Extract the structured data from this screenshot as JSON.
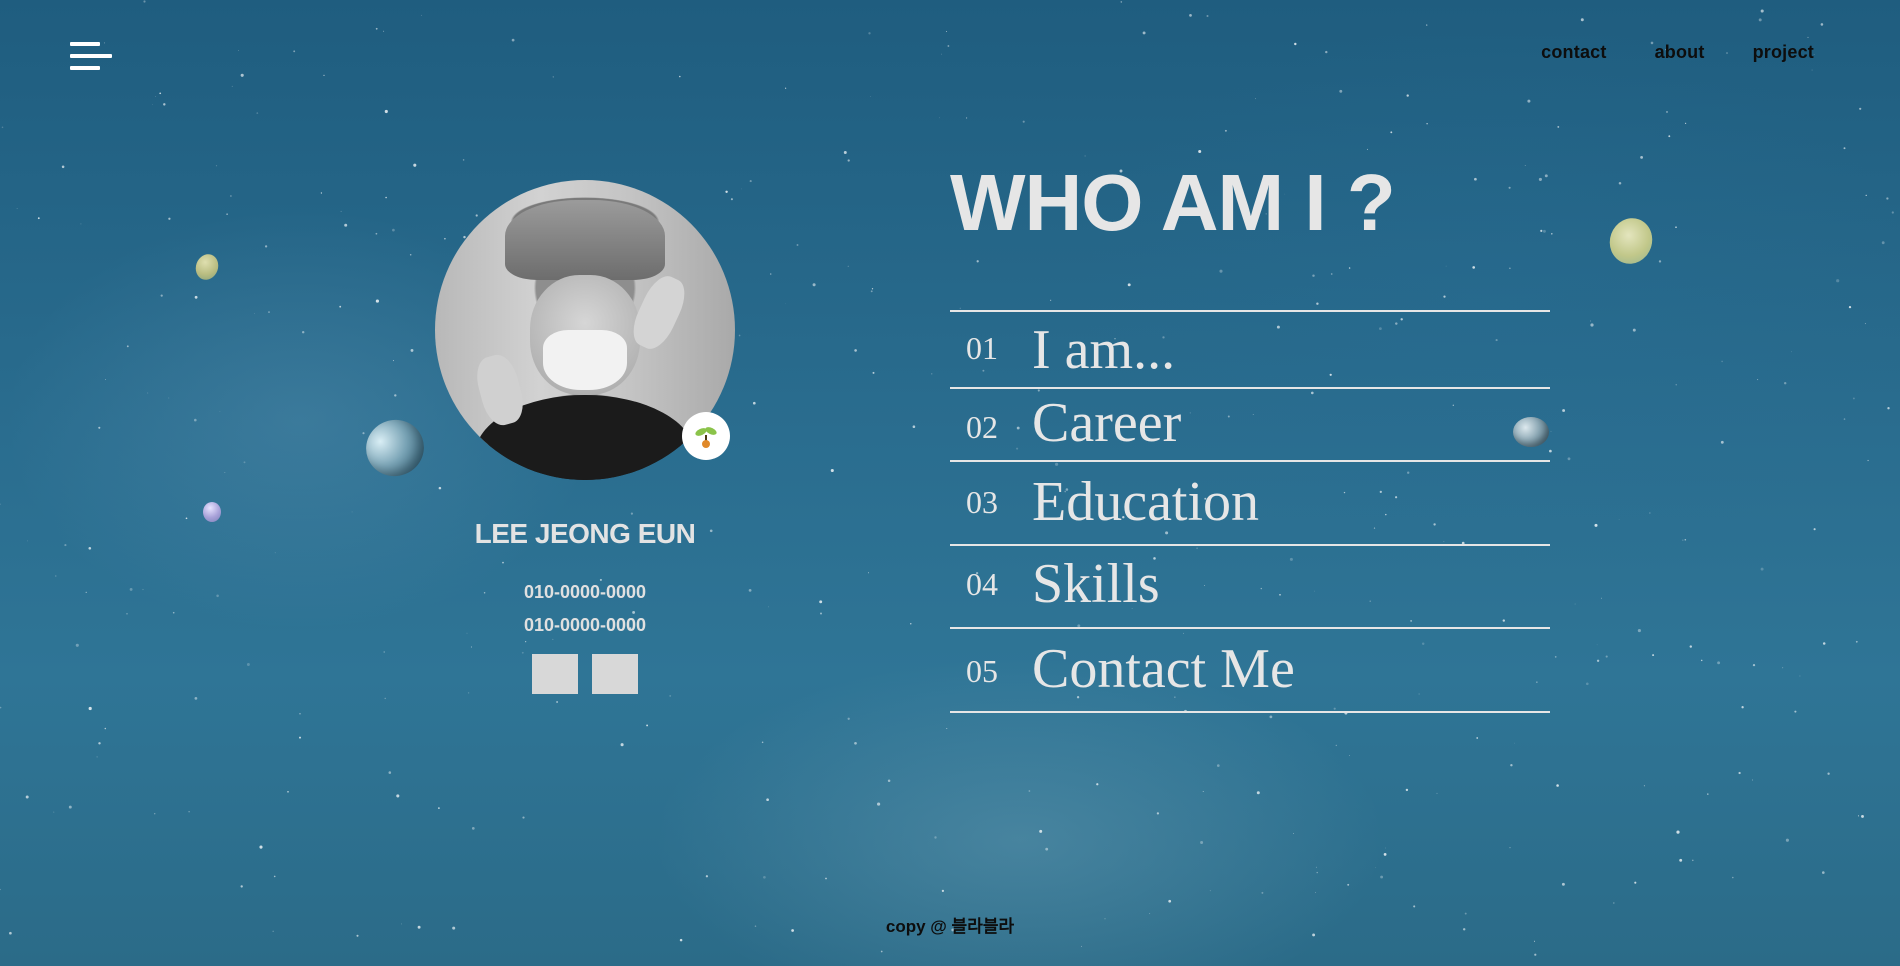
{
  "header": {
    "menu_icon": "hamburger-menu-icon",
    "nav": [
      {
        "label": "contact"
      },
      {
        "label": "about"
      },
      {
        "label": "project"
      }
    ]
  },
  "profile": {
    "name": "LEE JEONG EUN",
    "phones": [
      "010-0000-0000",
      "010-0000-0000"
    ],
    "badge_icon": "sprout-icon",
    "socials": [
      {
        "icon": "social-link-1"
      },
      {
        "icon": "social-link-2"
      }
    ]
  },
  "main": {
    "title": "WHO AM I ?",
    "items": [
      {
        "num": "01",
        "label": "I am..."
      },
      {
        "num": "02",
        "label": "Career"
      },
      {
        "num": "03",
        "label": "Education"
      },
      {
        "num": "04",
        "label": "Skills"
      },
      {
        "num": "05",
        "label": "Contact Me"
      }
    ]
  },
  "footer": {
    "text": "copy @ 블라블라"
  },
  "colors": {
    "background": "#2a6d8f",
    "text_light": "#e6e6e6",
    "text_dark": "#0d0d0d"
  }
}
